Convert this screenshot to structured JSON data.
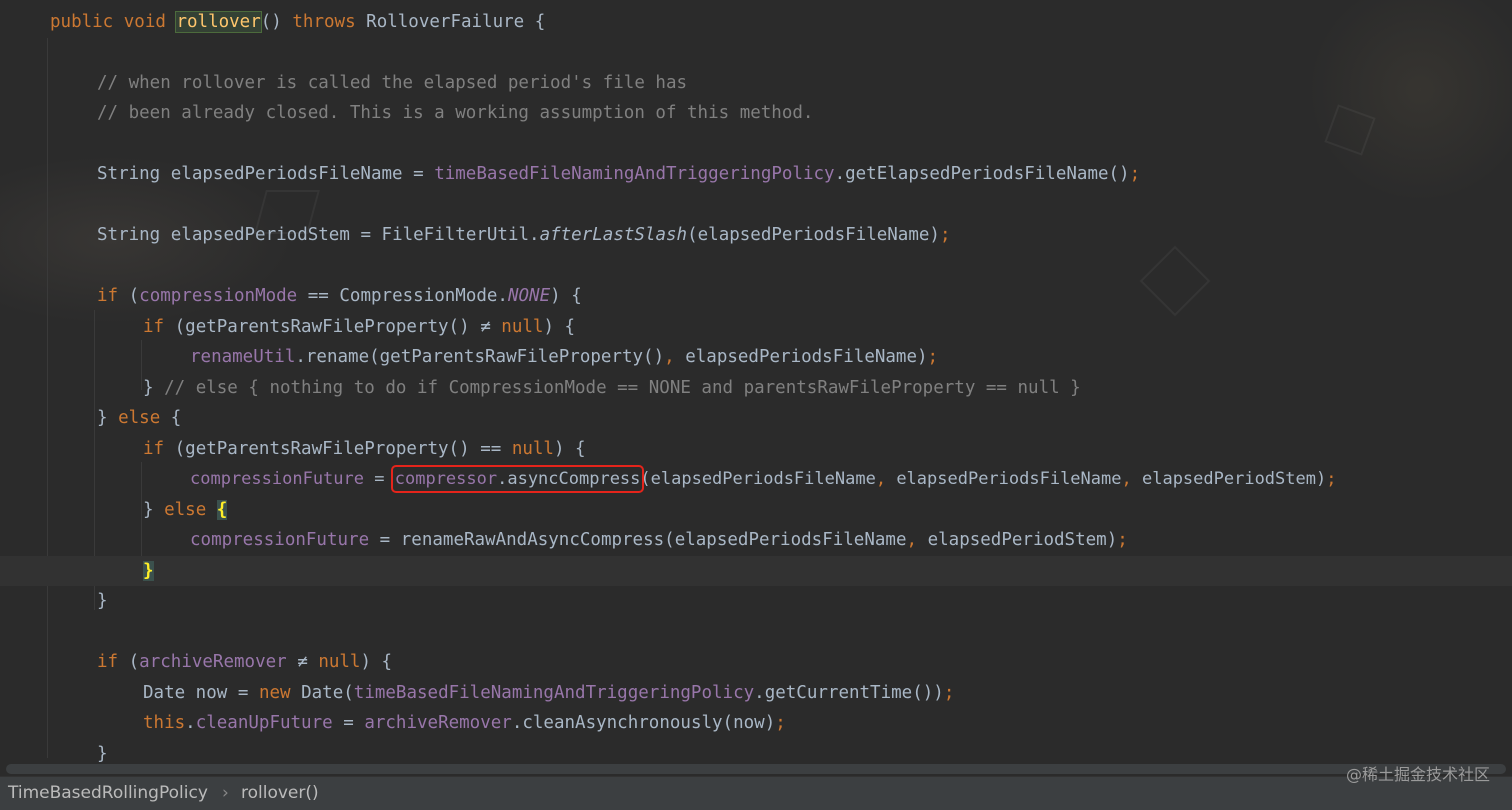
{
  "colors": {
    "background": "#2b2b2b",
    "keyword": "#cc7832",
    "comment": "#808080",
    "field": "#9876aa",
    "method_decl": "#ffc66d",
    "text": "#a9b7c6",
    "highlight_box": "#e5241b"
  },
  "code": {
    "l1": {
      "kw1": "public",
      "kw2": "void",
      "method": "rollover",
      "p1": "()",
      "kw3": "throws",
      "exc": "RolloverFailure",
      "brace": "{"
    },
    "l2": {
      "comment": "// when rollover is called the elapsed period's file has"
    },
    "l3": {
      "comment": "// been already closed. This is a working assumption of this method."
    },
    "l4": {
      "type": "String",
      "var": "elapsedPeriodsFileName",
      "eq": "=",
      "field": "timeBasedFileNamingAndTriggeringPolicy",
      "call": ".getElapsedPeriodsFileName()",
      "semi": ";"
    },
    "l5": {
      "type": "String",
      "var": "elapsedPeriodStem",
      "eq": "=",
      "cls": "FileFilterUtil.",
      "call": "afterLastSlash",
      "args": "(elapsedPeriodsFileName)",
      "semi": ";"
    },
    "l6": {
      "kw": "if",
      "open": "(",
      "field": "compressionMode",
      "op": "==",
      "cls": "CompressionMode.",
      "const": "NONE",
      "close": ") {"
    },
    "l7": {
      "kw": "if",
      "cond": "(getParentsRawFileProperty()",
      "op": "≠",
      "null": "null",
      "close": ") {"
    },
    "l8": {
      "field": "renameUtil",
      "call": ".rename(getParentsRawFileProperty()",
      "comma": ",",
      "arg": "elapsedPeriodsFileName)",
      "semi": ";"
    },
    "l9": {
      "brace": "}",
      "comment": "// else { nothing to do if CompressionMode == NONE and parentsRawFileProperty == null }"
    },
    "l10": {
      "brace": "}",
      "kw": "else",
      "brace2": "{"
    },
    "l11": {
      "kw": "if",
      "cond": "(getParentsRawFileProperty()",
      "op": "==",
      "null": "null",
      "close": ") {"
    },
    "l12": {
      "field": "compressionFuture",
      "eq": "=",
      "field2": "compressor",
      "call": ".asyncCompress",
      "args1": "(elapsedPeriodsFileName",
      "c1": ",",
      "args2": "elapsedPeriodsFileName",
      "c2": ",",
      "args3": "elapsedPeriodStem)",
      "semi": ";"
    },
    "l13": {
      "brace": "}",
      "kw": "else",
      "brace2": "{"
    },
    "l14": {
      "field": "compressionFuture",
      "eq": "=",
      "call": "renameRawAndAsyncCompress(elapsedPeriodsFileName",
      "comma": ",",
      "arg": "elapsedPeriodStem)",
      "semi": ";"
    },
    "l15": {
      "brace": "}"
    },
    "l16": {
      "brace": "}"
    },
    "l17": {
      "kw": "if",
      "open": "(",
      "field": "archiveRemover",
      "op": "≠",
      "null": "null",
      "close": ") {"
    },
    "l18": {
      "type": "Date now",
      "eq": "=",
      "kw": "new",
      "cls": "Date(",
      "field": "timeBasedFileNamingAndTriggeringPolicy",
      "call": ".getCurrentTime())",
      "semi": ";"
    },
    "l19": {
      "kw": "this",
      "dot": ".",
      "field": "cleanUpFuture",
      "eq": "=",
      "field2": "archiveRemover",
      "call": ".cleanAsynchronously(now)",
      "semi": ";"
    },
    "l20": {
      "brace": "}"
    }
  },
  "breadcrumb": {
    "item1": "TimeBasedRollingPolicy",
    "sep": "›",
    "item2": "rollover()"
  },
  "watermark": "@稀土掘金技术社区"
}
